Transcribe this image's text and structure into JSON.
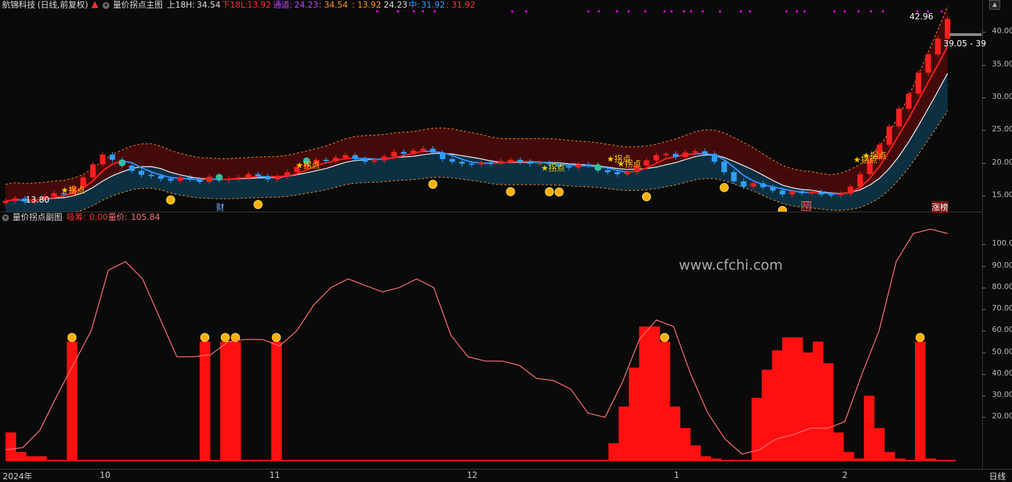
{
  "header": {
    "stock_name": "航锦科技",
    "period": "(日线,前复权)",
    "indicator_name": "量价拐点主图",
    "upper_label": "上18H:",
    "upper_value": "34.54",
    "lower_label": "下18L:",
    "lower_value": "13.92",
    "channel_label": "通道:",
    "channel_value": "24.23",
    "c1": ": 34.54",
    "c2": ": 13.92",
    "c3": ": 24.23",
    "mid_label": "中:",
    "mid_value": "31.92",
    "last_value": ": 31.92"
  },
  "sub_header": {
    "indicator_name": "量价拐点副图",
    "absorb_label": "吸筹:",
    "absorb_value": "0.00",
    "volprice_label": "量价:",
    "volprice_value": "105.84"
  },
  "main_axis": {
    "labels": [
      "40.00",
      "35.00",
      "30.00",
      "25.00",
      "20.00",
      "15.00"
    ],
    "values": [
      40,
      35,
      30,
      25,
      20,
      15
    ]
  },
  "sub_axis": {
    "labels": [
      "100.00",
      "90.00",
      "80.00",
      "70.00",
      "60.00",
      "50.00",
      "40.00",
      "30.00",
      "20.00"
    ],
    "values": [
      100,
      90,
      80,
      70,
      60,
      50,
      40,
      30,
      20
    ]
  },
  "x_axis": {
    "labels": [
      "2024年",
      "10",
      "11",
      "12",
      "1",
      "2"
    ]
  },
  "annotations": {
    "high_price": "42.96",
    "range_label": "39.05 - 39",
    "low_price": "13.80",
    "turn_point": "拐点",
    "turn_points": [
      "★拐点",
      "★拐点",
      "★拐点",
      "★拐点",
      "★拐点",
      "★拐点",
      "★拐点"
    ],
    "cai": "财",
    "yu": "预",
    "zhangbang": "涨榜"
  },
  "watermark": "www.cfchi.com",
  "timeframe": "日线",
  "colors": {
    "up": "#ff2020",
    "down": "#2fa0ff",
    "bull_band": "#4a0a0a",
    "bear_band": "#0d3345",
    "line": "#ff7070",
    "accent": "#ffd000"
  },
  "chart_data": [
    {
      "type": "line",
      "name": "main",
      "price_range": [
        13,
        43
      ],
      "x_count": 92,
      "close": [
        14.2,
        14.6,
        14.1,
        14.5,
        14.9,
        15.4,
        15.2,
        16.3,
        17.8,
        19.8,
        21.3,
        20.5,
        19.6,
        18.8,
        18.2,
        18.0,
        17.6,
        17.3,
        17.8,
        17.5,
        17.1,
        17.9,
        17.4,
        17.6,
        17.8,
        18.3,
        18.0,
        17.5,
        17.9,
        18.6,
        19.4,
        19.9,
        20.5,
        20.3,
        20.8,
        21.2,
        20.6,
        20.2,
        20.4,
        21.0,
        21.7,
        21.4,
        21.9,
        22.2,
        21.6,
        20.6,
        20.2,
        19.9,
        19.8,
        20.1,
        19.9,
        20.3,
        20.5,
        20.2,
        19.9,
        20.0,
        19.8,
        19.5,
        19.3,
        19.8,
        19.7,
        18.9,
        18.6,
        18.3,
        18.6,
        19.6,
        20.4,
        21.2,
        21.4,
        20.9,
        21.6,
        21.8,
        21.4,
        20.2,
        18.6,
        17.2,
        16.4,
        16.9,
        16.3,
        15.8,
        15.2,
        15.7,
        15.4,
        15.6,
        15.2,
        15.1,
        15.3,
        16.4,
        18.3,
        20.6,
        22.8,
        25.6,
        28.3,
        30.6,
        33.8,
        36.6,
        39.0,
        42.0
      ]
    },
    {
      "type": "bar",
      "name": "吸筹",
      "values": [
        13,
        4,
        2,
        2,
        0,
        0,
        55,
        0,
        0,
        0,
        0,
        0,
        0,
        0,
        0,
        0,
        0,
        0,
        0,
        55,
        0,
        55,
        55,
        0,
        0,
        0,
        55,
        0,
        0,
        0,
        0,
        0,
        0,
        0,
        0,
        0,
        0,
        0,
        0,
        0,
        0,
        0,
        0,
        0,
        0,
        0,
        0,
        0,
        0,
        0,
        0,
        0,
        0,
        0,
        0,
        0,
        0,
        0,
        0,
        8,
        25,
        43,
        62,
        62,
        55,
        25,
        15,
        7,
        2,
        1,
        0,
        0,
        0,
        29,
        42,
        51,
        57,
        57,
        50,
        55,
        45,
        13,
        4,
        1,
        30,
        15,
        4,
        1,
        0,
        55,
        1,
        0,
        0
      ]
    },
    {
      "type": "line",
      "name": "量价",
      "values": [
        5,
        6,
        14,
        30,
        45,
        60,
        88,
        92,
        84,
        66,
        48,
        48,
        49,
        55,
        56,
        56,
        53,
        60,
        72,
        80,
        84,
        81,
        78,
        80,
        84,
        80,
        58,
        48,
        46,
        46,
        44,
        38,
        37,
        33,
        22,
        20,
        36,
        56,
        65,
        62,
        40,
        22,
        10,
        3,
        5,
        10,
        12,
        15,
        15,
        18,
        40,
        60,
        92,
        105,
        107,
        105
      ]
    }
  ]
}
